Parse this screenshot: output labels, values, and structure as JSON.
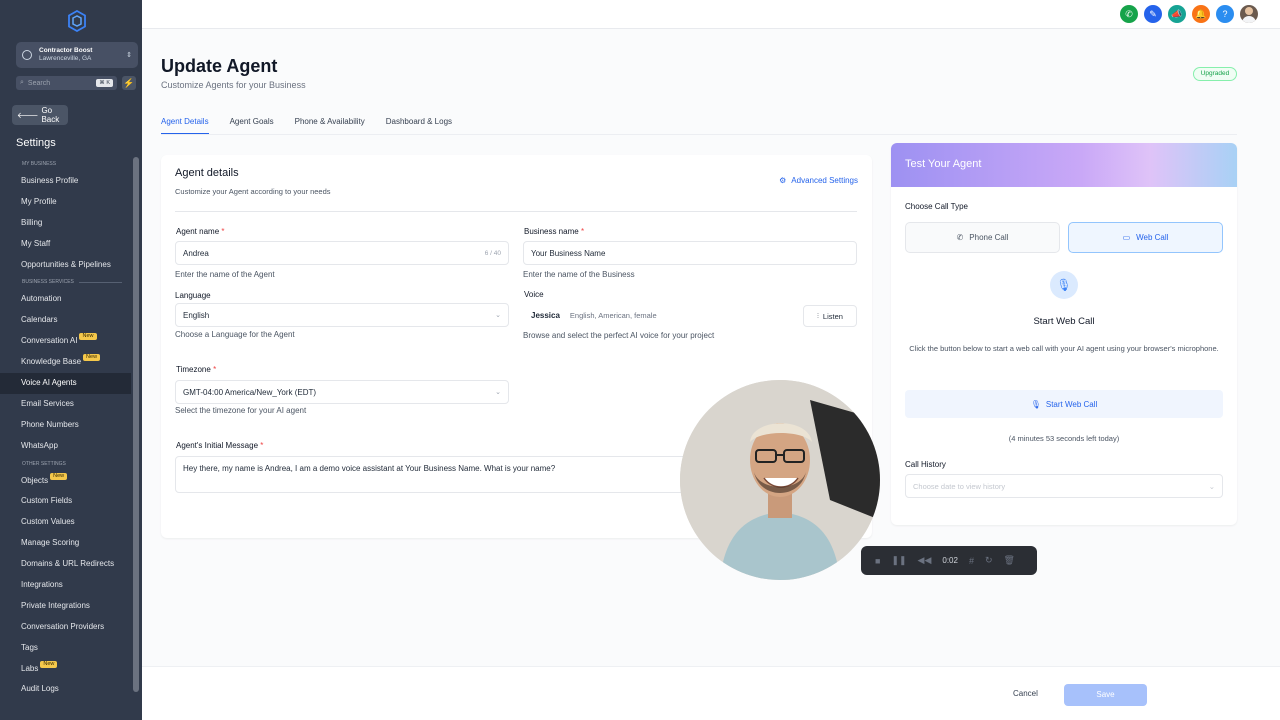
{
  "sidebar": {
    "location_name": "Contractor Boost",
    "location_city": "Lawrenceville, GA",
    "search_placeholder": "Search",
    "search_shortcut": "⌘ K",
    "go_back": "Go Back",
    "settings_title": "Settings",
    "sections": {
      "my_business": "MY BUSINESS",
      "business_services": "BUSINESS SERVICES",
      "other_settings": "OTHER SETTINGS"
    },
    "items": {
      "business_profile": "Business Profile",
      "my_profile": "My Profile",
      "billing": "Billing",
      "my_staff": "My Staff",
      "opportunities": "Opportunities & Pipelines",
      "automation": "Automation",
      "calendars": "Calendars",
      "conversation_ai": "Conversation AI",
      "knowledge_base": "Knowledge Base",
      "voice_ai_agents": "Voice AI Agents",
      "email_services": "Email Services",
      "phone_numbers": "Phone Numbers",
      "whatsapp": "WhatsApp",
      "objects": "Objects",
      "custom_fields": "Custom Fields",
      "custom_values": "Custom Values",
      "manage_scoring": "Manage Scoring",
      "domains": "Domains & URL Redirects",
      "integrations": "Integrations",
      "private_integrations": "Private Integrations",
      "conversation_providers": "Conversation Providers",
      "tags": "Tags",
      "labs": "Labs",
      "audit_logs": "Audit Logs"
    },
    "new_badge": "New"
  },
  "topbar": {
    "colors": {
      "phone": "#16a34a",
      "marketing": "#2563eb",
      "announce": "#16a394",
      "bell": "#f97316",
      "help": "#2b8df0"
    }
  },
  "page": {
    "title": "Update Agent",
    "subtitle": "Customize Agents for your Business",
    "badge": "Upgraded",
    "tabs": [
      "Agent Details",
      "Agent Goals",
      "Phone & Availability",
      "Dashboard & Logs"
    ]
  },
  "agent_details": {
    "heading": "Agent details",
    "subheading": "Customize your Agent according to your needs",
    "advanced_settings": "Advanced Settings",
    "agent_name_label": "Agent name",
    "agent_name_value": "Andrea",
    "agent_name_count": "6 / 40",
    "agent_name_hint": "Enter the name of the Agent",
    "business_name_label": "Business name",
    "business_name_value": "Your Business Name",
    "business_name_hint": "Enter the name of the Business",
    "language_label": "Language",
    "language_value": "English",
    "language_hint": "Choose a Language for the Agent",
    "voice_label": "Voice",
    "voice_name": "Jessica",
    "voice_desc": "English, American, female",
    "listen": "Listen",
    "voice_hint": "Browse and select the perfect AI voice for your project",
    "timezone_label": "Timezone",
    "timezone_value": "GMT-04:00 America/New_York (EDT)",
    "timezone_hint": "Select the timezone for your AI agent",
    "initial_message_label": "Agent's Initial Message",
    "initial_message_value": "Hey there, my name is Andrea, I am a demo voice assistant at Your Business Name. What is your name?",
    "required_mark": "*"
  },
  "test_panel": {
    "title": "Test Your Agent",
    "call_type_label": "Choose Call Type",
    "phone_call": "Phone Call",
    "web_call": "Web Call",
    "start_heading": "Start Web Call",
    "description": "Click the button below to start a web call with your AI agent using your browser's microphone.",
    "start_button": "Start Web Call",
    "time_left": "(4 minutes 53 seconds left today)",
    "history_label": "Call History",
    "history_placeholder": "Choose date to view history"
  },
  "recorder": {
    "time": "0:02"
  },
  "footer": {
    "cancel": "Cancel",
    "save": "Save"
  }
}
